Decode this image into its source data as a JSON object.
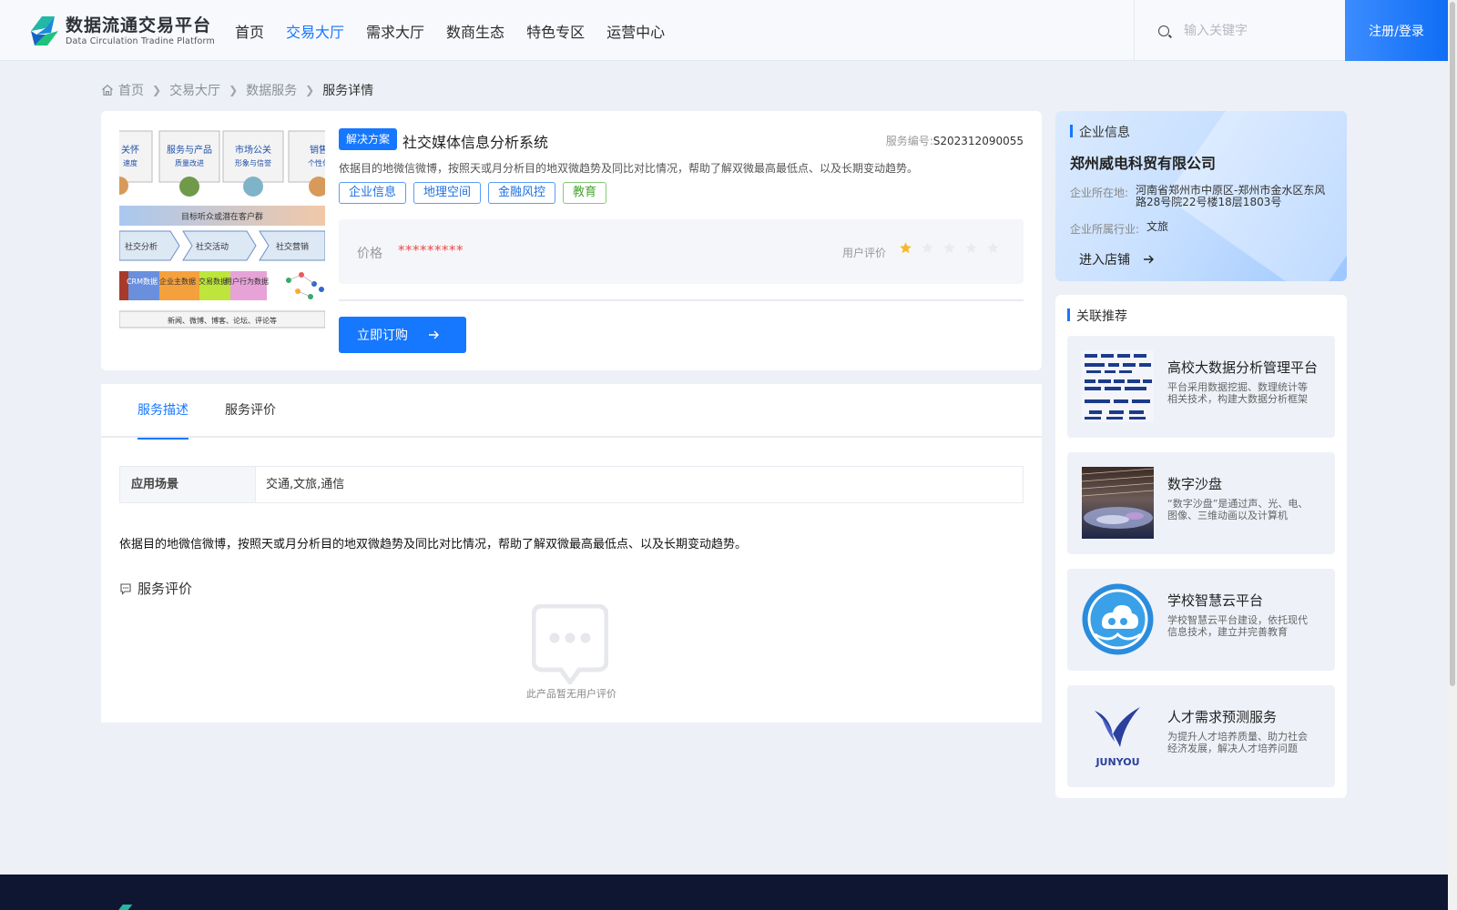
{
  "header": {
    "logo_cn": "数据流通交易平台",
    "logo_en": "Data Circulation Tradine Platform",
    "nav": [
      {
        "label": "首页",
        "active": false
      },
      {
        "label": "交易大厅",
        "active": true
      },
      {
        "label": "需求大厅",
        "active": false
      },
      {
        "label": "数商生态",
        "active": false
      },
      {
        "label": "特色专区",
        "active": false
      },
      {
        "label": "运营中心",
        "active": false
      }
    ],
    "search_placeholder": "输入关键字",
    "login_label": "注册/登录"
  },
  "breadcrumb": [
    "首页",
    "交易大厅",
    "数据服务",
    "服务详情"
  ],
  "product": {
    "type_badge": "解决方案",
    "title": "社交媒体信息分析系统",
    "service_no_label": "服务编号:",
    "service_no": "S202312090055",
    "description": "依据目的地微信微博，按照天或月分析目的地双微趋势及同比对比情况，帮助了解双微最高最低点、以及长期变动趋势。",
    "tags": [
      {
        "label": "企业信息",
        "style": "blue"
      },
      {
        "label": "地理空间",
        "style": "blue"
      },
      {
        "label": "金融风控",
        "style": "blue"
      },
      {
        "label": "教育",
        "style": "green"
      }
    ],
    "price_label": "价格",
    "price_value": "*********",
    "rating_label": "用户评价",
    "rating": 1,
    "rating_max": 5,
    "buy_label": "立即订购",
    "image_text": {
      "boxes": [
        {
          "title": "关怀",
          "sub": "速度"
        },
        {
          "title": "服务与产品",
          "sub": "质量改进"
        },
        {
          "title": "市场公关",
          "sub": "形象与信誉"
        },
        {
          "title": "销售",
          "sub": "个性化"
        }
      ],
      "banner": "目标听众或潜在客户群",
      "steps": [
        "社交分析",
        "社交活动",
        "社交营销"
      ],
      "data_blocks": [
        "CRM数据",
        "企业主数据",
        "交易数据",
        "用户行为数据"
      ],
      "sources": "新闻、微博、博客、论坛、评论等"
    }
  },
  "tabs": [
    {
      "label": "服务描述",
      "active": true
    },
    {
      "label": "服务评价",
      "active": false
    }
  ],
  "details": {
    "scene_key": "应用场景",
    "scene_value": "交通,文旅,通信",
    "text": "依据目的地微信微博，按照天或月分析目的地双微趋势及同比对比情况，帮助了解双微最高最低点、以及长期变动趋势。",
    "review_title": "服务评价",
    "empty_text": "此产品暂无用户评价"
  },
  "company": {
    "section_title": "企业信息",
    "name": "郑州威电科贸有限公司",
    "location_label": "企业所在地:",
    "location": "河南省郑州市中原区-郑州市金水区东风路28号院22号楼18层1803号",
    "industry_label": "企业所属行业:",
    "industry": "文旅",
    "enter_label": "进入店铺"
  },
  "recommend": {
    "section_title": "关联推荐",
    "items": [
      {
        "title": "高校大数据分析管理平台",
        "desc": "平台采用数据挖掘、数理统计等相关技术，构建大数据分析框架"
      },
      {
        "title": "数字沙盘",
        "desc": "“数字沙盘”是通过声、光、电、图像、三维动画以及计算机"
      },
      {
        "title": "学校智慧云平台",
        "desc": "学校智慧云平台建设，依托现代信息技术，建立并完善教育"
      },
      {
        "title": "人才需求预测服务",
        "desc": "为提升人才培养质量、助力社会经济发展，解决人才培养问题"
      }
    ],
    "junyou_text": "JUNYOU"
  },
  "colors": {
    "primary": "#1677ff",
    "price": "#f04a4a",
    "star": "#f5b828",
    "footer": "#0f1631"
  }
}
